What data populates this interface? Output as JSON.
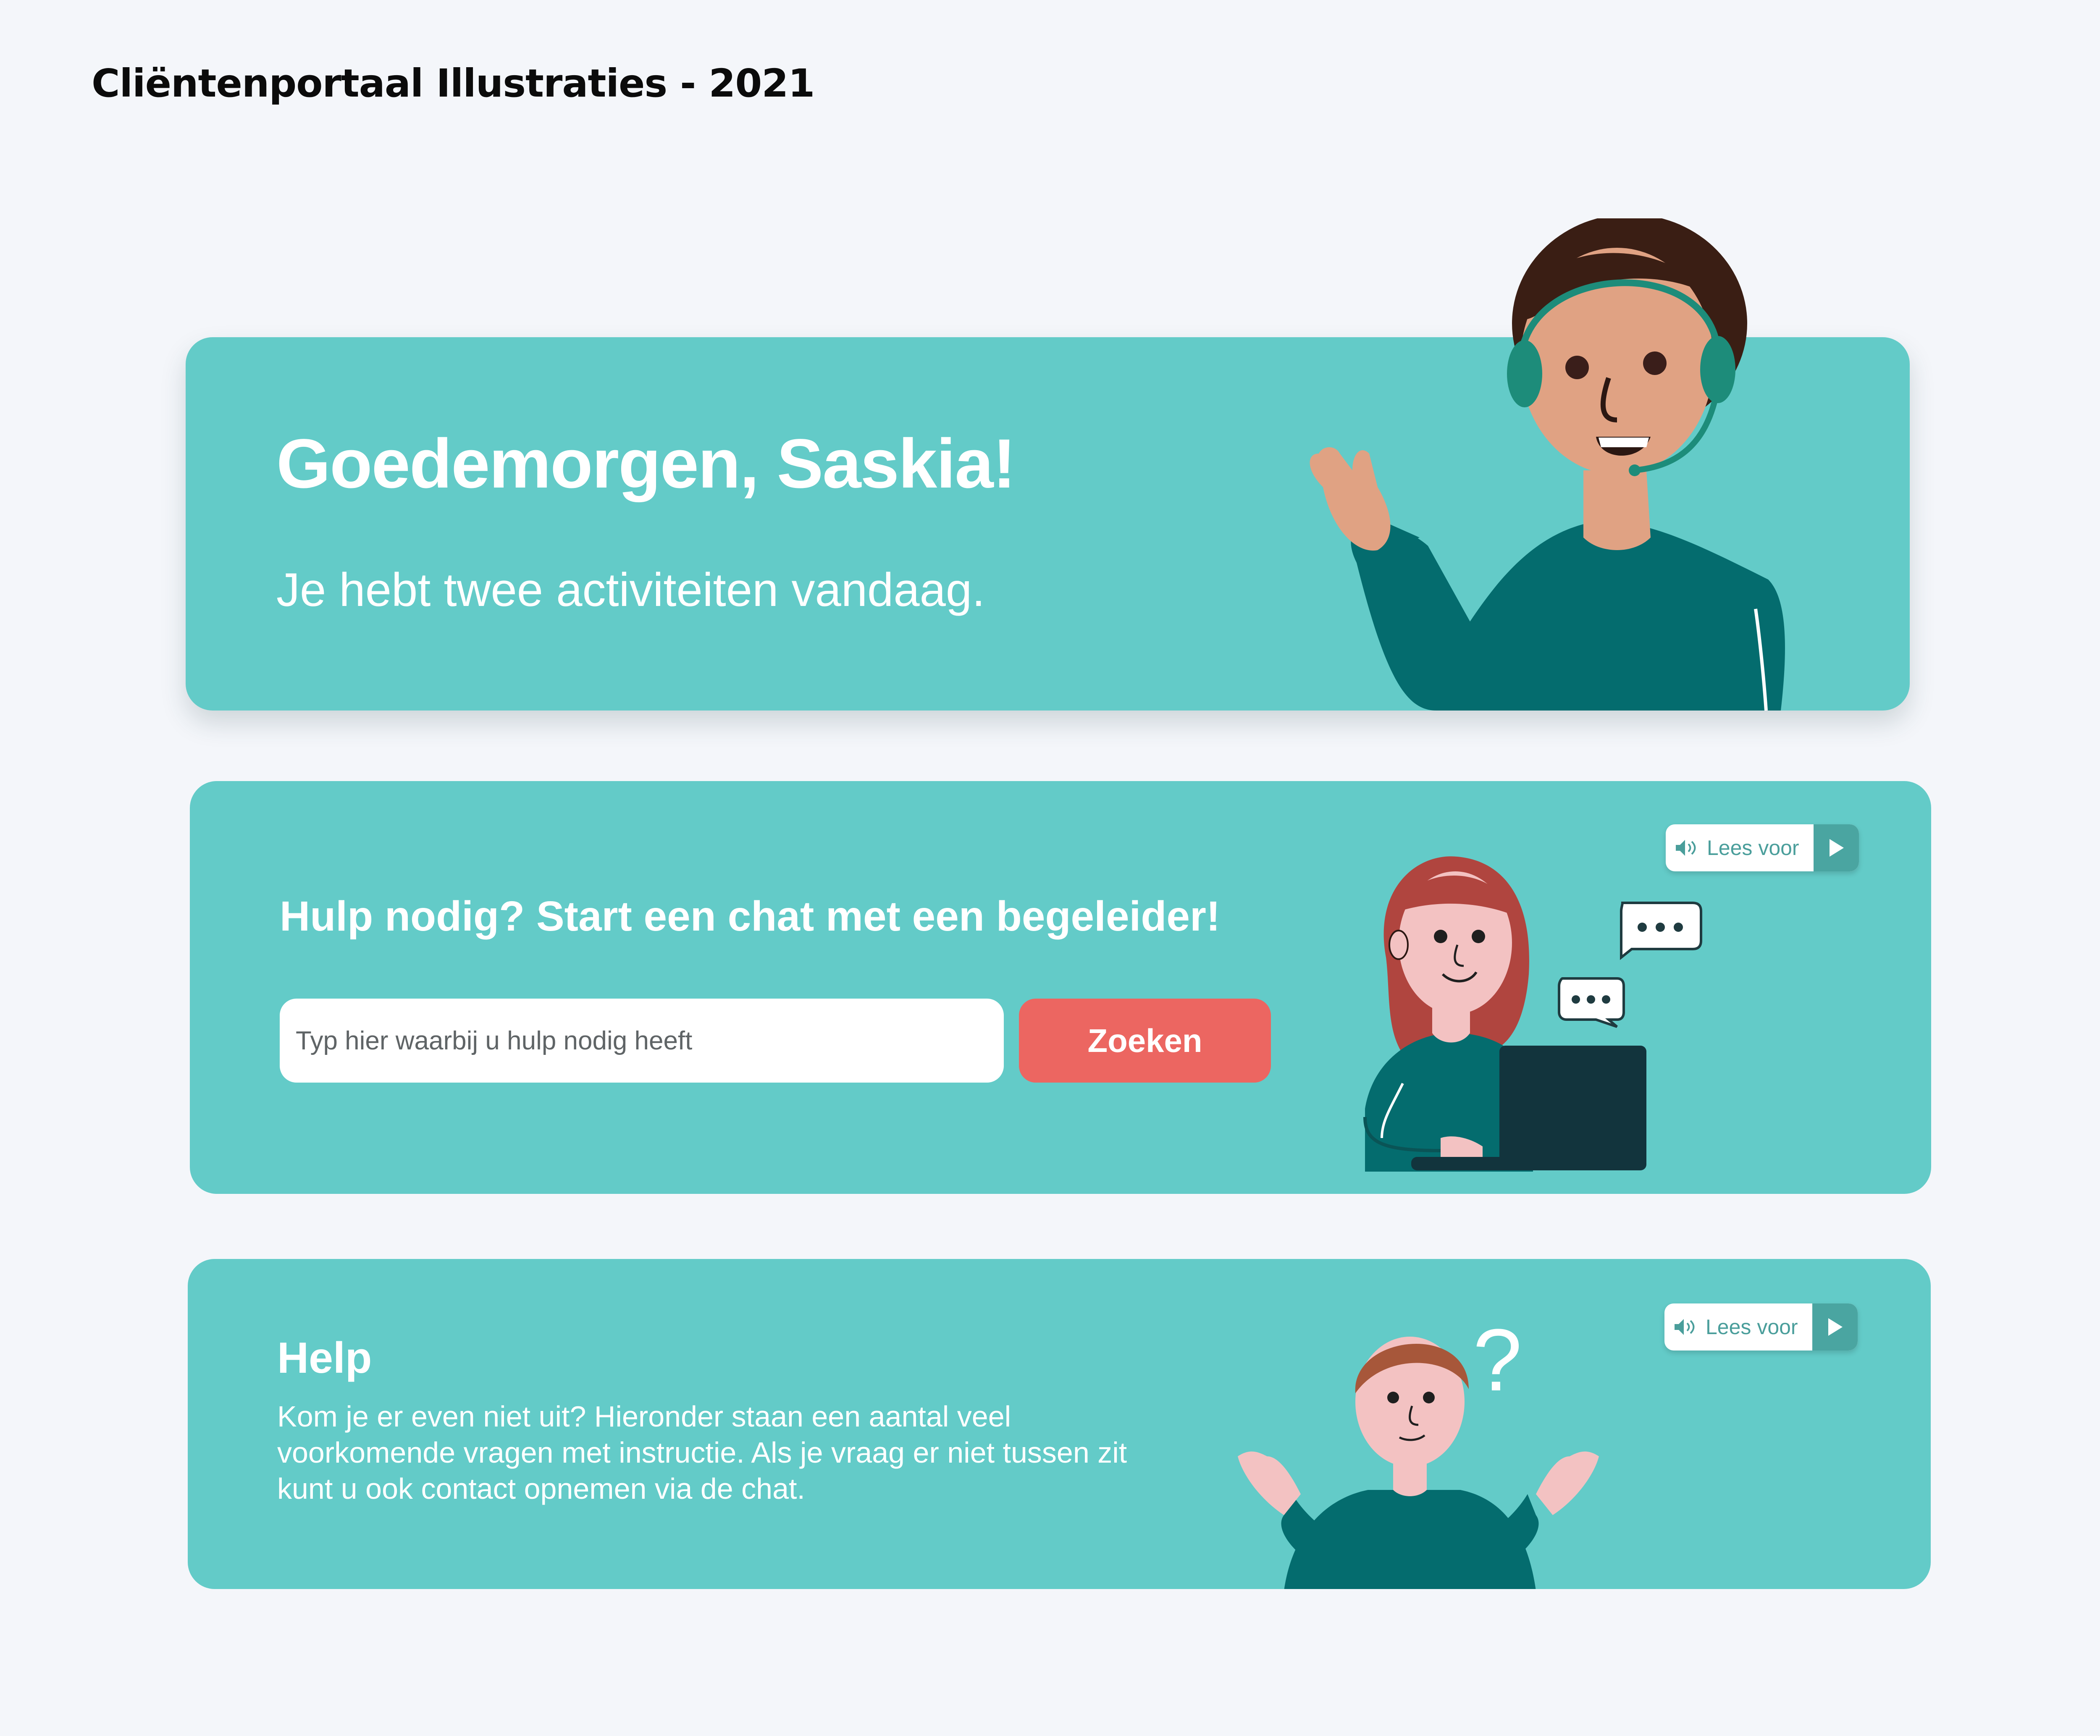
{
  "page": {
    "title": "Cliëntenportaal Illustraties - 2021"
  },
  "welcome_card": {
    "heading": "Goedemorgen, Saskia!",
    "subtext": "Je hebt twee activiteiten vandaag."
  },
  "chat_card": {
    "heading": "Hulp nodig? Start een chat met een begeleider!",
    "search_placeholder": "Typ hier waarbij u hulp nodig heeft",
    "search_button": "Zoeken",
    "read_aloud": "Lees voor"
  },
  "help_card": {
    "heading": "Help",
    "body": "Kom je er even niet uit? Hieronder staan een aantal veel voorkomende vragen met instructie. Als je vraag er niet tussen zit kunt u ook contact opnemen via de chat.",
    "read_aloud": "Lees voor",
    "question_mark": "?"
  },
  "colors": {
    "card_bg": "#63cbc8",
    "page_bg": "#f4f6fa",
    "button_red": "#ec6661",
    "shirt_teal": "#046c6e",
    "read_play": "#4aa5a1"
  },
  "icons": [
    "speaker-icon",
    "play-icon",
    "chat-bubble-icon"
  ]
}
